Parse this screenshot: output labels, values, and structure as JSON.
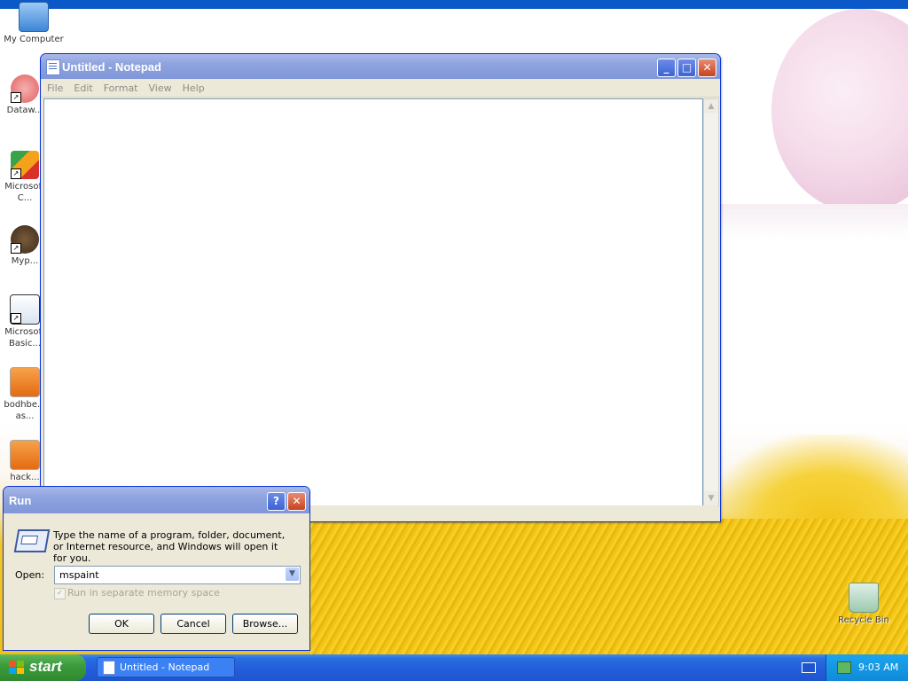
{
  "desktop": {
    "icons": [
      {
        "label": "My Computer"
      },
      {
        "label": "Dataw..."
      },
      {
        "label": "Microsoft\nC..."
      },
      {
        "label": "Myp..."
      },
      {
        "label": "Microsoft\nBasic..."
      },
      {
        "label": "bodhbe...\nas..."
      },
      {
        "label": "hack..."
      }
    ],
    "recycle_bin": "Recycle Bin"
  },
  "notepad": {
    "title": "Untitled - Notepad",
    "menu": [
      "File",
      "Edit",
      "Format",
      "View",
      "Help"
    ],
    "content": ""
  },
  "run_dialog": {
    "title": "Run",
    "help_button": "?",
    "close_button": "✕",
    "description": "Type the name of a program, folder, document, or Internet resource, and Windows will open it for you.",
    "open_label": "Open:",
    "open_value": "mspaint",
    "checkbox_label": "Run in separate memory space",
    "ok": "OK",
    "cancel": "Cancel",
    "browse": "Browse..."
  },
  "taskbar": {
    "start": "start",
    "task_button": "Untitled - Notepad",
    "time": "9:03 AM"
  }
}
